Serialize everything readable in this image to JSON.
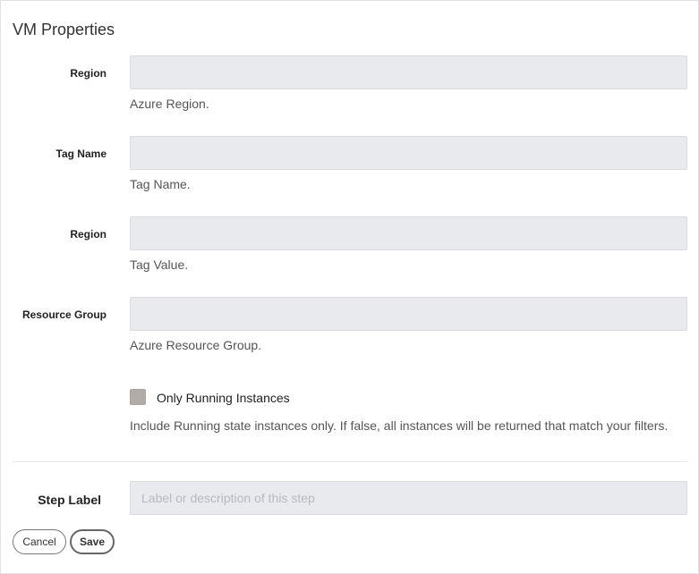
{
  "section": {
    "title": "VM Properties"
  },
  "fields": [
    {
      "label": "Region",
      "value": "",
      "help": "Azure Region."
    },
    {
      "label": "Tag Name",
      "value": "",
      "help": "Tag Name."
    },
    {
      "label": "Region",
      "value": "",
      "help": "Tag Value."
    },
    {
      "label": "Resource Group",
      "value": "",
      "help": "Azure Resource Group."
    }
  ],
  "running_only": {
    "label": "Only Running Instances",
    "checked": false,
    "help": "Include Running state instances only. If false, all instances will be returned that match your filters."
  },
  "step": {
    "label": "Step Label",
    "value": "",
    "placeholder": "Label or description of this step"
  },
  "actions": {
    "cancel_label": "Cancel",
    "save_label": "Save"
  }
}
